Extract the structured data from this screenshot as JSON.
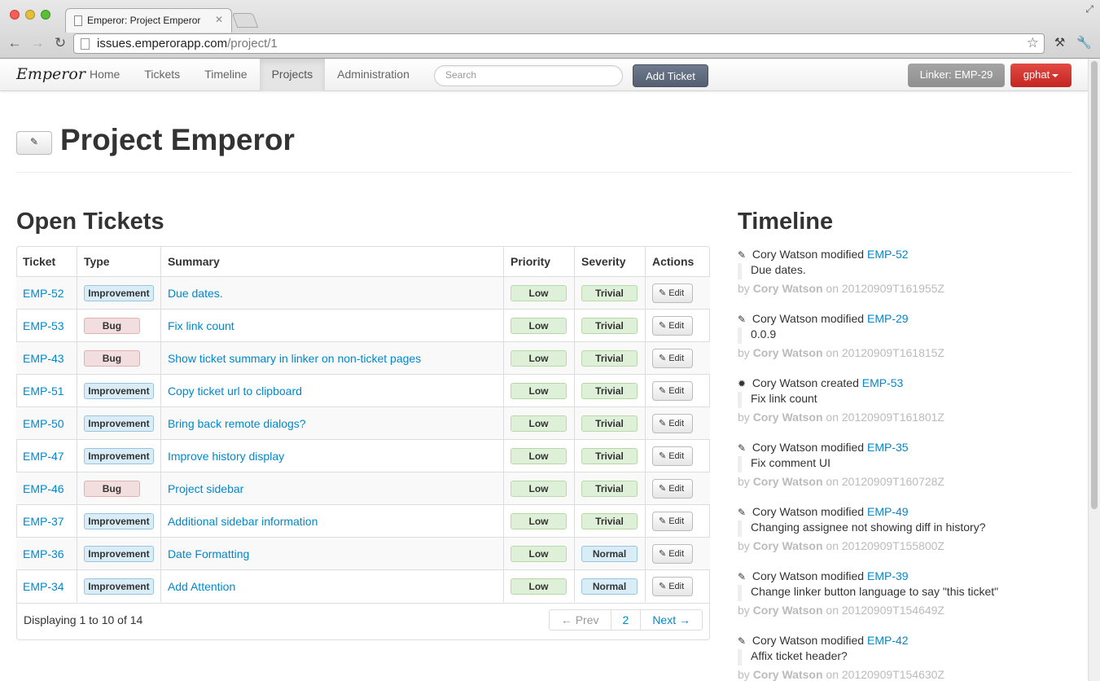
{
  "browser": {
    "tab_title": "Emperor: Project Emperor",
    "url_host": "issues.emperorapp.com",
    "url_path": "/project/1"
  },
  "navbar": {
    "brand": "Emperor",
    "items": [
      "Home",
      "Tickets",
      "Timeline",
      "Projects",
      "Administration"
    ],
    "active": "Projects",
    "search_placeholder": "Search",
    "add_ticket": "Add Ticket",
    "linker": "Linker: EMP-29",
    "user": "gphat"
  },
  "page": {
    "title": "Project Emperor"
  },
  "open_tickets": {
    "title": "Open Tickets",
    "columns": [
      "Ticket",
      "Type",
      "Summary",
      "Priority",
      "Severity",
      "Actions"
    ],
    "rows": [
      {
        "id": "EMP-52",
        "type": "Improvement",
        "summary": "Due dates.",
        "priority": "Low",
        "severity": "Trivial",
        "action": "Edit"
      },
      {
        "id": "EMP-53",
        "type": "Bug",
        "summary": "Fix link count",
        "priority": "Low",
        "severity": "Trivial",
        "action": "Edit"
      },
      {
        "id": "EMP-43",
        "type": "Bug",
        "summary": "Show ticket summary in linker on non-ticket pages",
        "priority": "Low",
        "severity": "Trivial",
        "action": "Edit"
      },
      {
        "id": "EMP-51",
        "type": "Improvement",
        "summary": "Copy ticket url to clipboard",
        "priority": "Low",
        "severity": "Trivial",
        "action": "Edit"
      },
      {
        "id": "EMP-50",
        "type": "Improvement",
        "summary": "Bring back remote dialogs?",
        "priority": "Low",
        "severity": "Trivial",
        "action": "Edit"
      },
      {
        "id": "EMP-47",
        "type": "Improvement",
        "summary": "Improve history display",
        "priority": "Low",
        "severity": "Trivial",
        "action": "Edit"
      },
      {
        "id": "EMP-46",
        "type": "Bug",
        "summary": "Project sidebar",
        "priority": "Low",
        "severity": "Trivial",
        "action": "Edit"
      },
      {
        "id": "EMP-37",
        "type": "Improvement",
        "summary": "Additional sidebar information",
        "priority": "Low",
        "severity": "Trivial",
        "action": "Edit"
      },
      {
        "id": "EMP-36",
        "type": "Improvement",
        "summary": "Date Formatting",
        "priority": "Low",
        "severity": "Normal",
        "action": "Edit"
      },
      {
        "id": "EMP-34",
        "type": "Improvement",
        "summary": "Add Attention",
        "priority": "Low",
        "severity": "Normal",
        "action": "Edit"
      }
    ],
    "displaying": "Displaying 1 to 10 of 14",
    "pager": {
      "prev": "← Prev",
      "page": "2",
      "next": "Next →"
    }
  },
  "timeline": {
    "title": "Timeline",
    "entries": [
      {
        "icon": "pencil-icon",
        "who": "Cory Watson",
        "verb": "modified",
        "ticket": "EMP-52",
        "text": "Due dates.",
        "by": "by",
        "author": "Cory Watson",
        "on": "on",
        "date": "20120909T161955Z"
      },
      {
        "icon": "pencil-icon",
        "who": "Cory Watson",
        "verb": "modified",
        "ticket": "EMP-29",
        "text": "0.0.9",
        "by": "by",
        "author": "Cory Watson",
        "on": "on",
        "date": "20120909T161815Z"
      },
      {
        "icon": "asterisk-icon",
        "who": "Cory Watson",
        "verb": "created",
        "ticket": "EMP-53",
        "text": "Fix link count",
        "by": "by",
        "author": "Cory Watson",
        "on": "on",
        "date": "20120909T161801Z"
      },
      {
        "icon": "pencil-icon",
        "who": "Cory Watson",
        "verb": "modified",
        "ticket": "EMP-35",
        "text": "Fix comment UI",
        "by": "by",
        "author": "Cory Watson",
        "on": "on",
        "date": "20120909T160728Z"
      },
      {
        "icon": "pencil-icon",
        "who": "Cory Watson",
        "verb": "modified",
        "ticket": "EMP-49",
        "text": "Changing assignee not showing diff in history?",
        "by": "by",
        "author": "Cory Watson",
        "on": "on",
        "date": "20120909T155800Z"
      },
      {
        "icon": "pencil-icon",
        "who": "Cory Watson",
        "verb": "modified",
        "ticket": "EMP-39",
        "text": "Change linker button language to say \"this ticket\"",
        "by": "by",
        "author": "Cory Watson",
        "on": "on",
        "date": "20120909T154649Z"
      },
      {
        "icon": "pencil-icon",
        "who": "Cory Watson",
        "verb": "modified",
        "ticket": "EMP-42",
        "text": "Affix ticket header?",
        "by": "by",
        "author": "Cory Watson",
        "on": "on",
        "date": "20120909T154630Z"
      }
    ]
  }
}
